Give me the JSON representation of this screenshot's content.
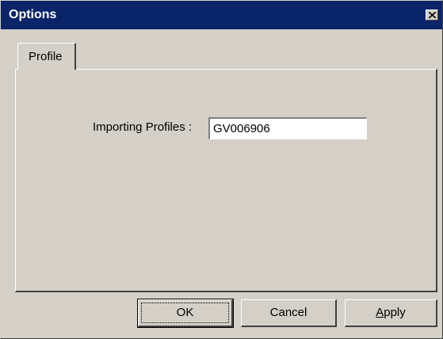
{
  "window": {
    "title": "Options",
    "close_icon": "close-x-icon"
  },
  "tabs": [
    {
      "label": "Profile",
      "selected": true
    }
  ],
  "form": {
    "importing_profiles_label": "Importing Profiles :",
    "importing_profiles_value": "GV006906"
  },
  "buttons": {
    "ok_label": "OK",
    "cancel_label": "Cancel",
    "apply_first_letter": "A",
    "apply_rest": "pply"
  },
  "colors": {
    "titlebar": "#0a246a",
    "face": "#d4d0c8"
  }
}
